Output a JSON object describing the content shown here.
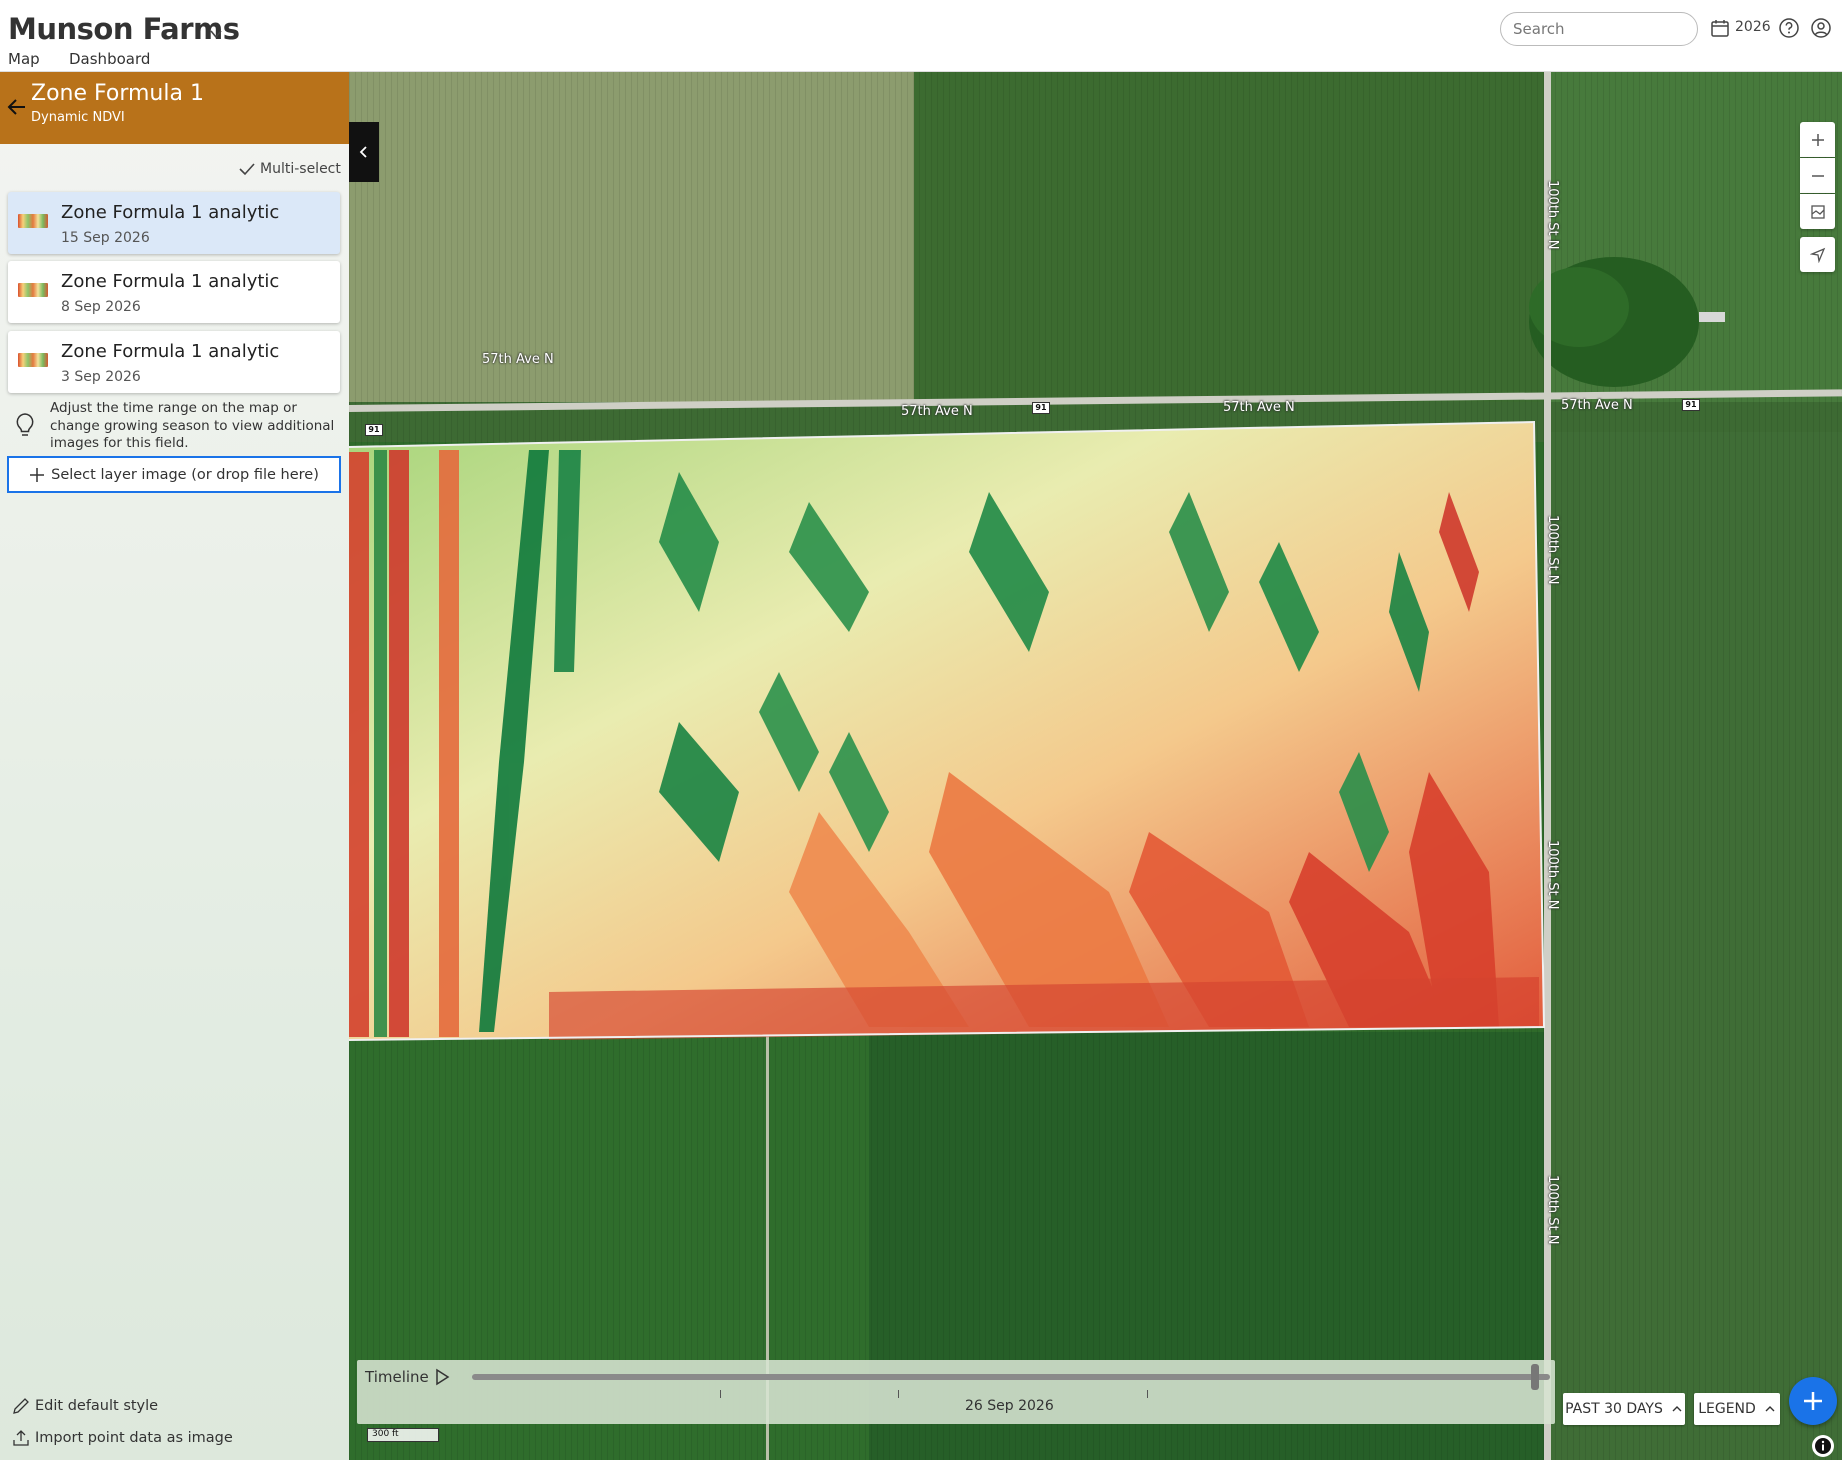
{
  "header": {
    "brand": "Munson Farms",
    "tabs": [
      {
        "label": "Map",
        "active": true
      },
      {
        "label": "Dashboard",
        "active": false
      }
    ],
    "search_placeholder": "Search",
    "year": "2026"
  },
  "sidebar": {
    "title": "Zone Formula 1",
    "subtitle": "Dynamic NDVI",
    "header_color": "#b8721a",
    "multiselect_label": "Multi-select",
    "items": [
      {
        "title": "Zone Formula 1 analytic",
        "date": "15 Sep 2026",
        "selected": true
      },
      {
        "title": "Zone Formula 1 analytic",
        "date": "8 Sep 2026",
        "selected": false
      },
      {
        "title": "Zone Formula 1 analytic",
        "date": "3 Sep 2026",
        "selected": false
      }
    ],
    "tip": "Adjust the time range on the map or change growing season to view additional images for this field.",
    "select_layer_label": "Select layer image (or drop file here)",
    "edit_style_label": "Edit default style",
    "import_label": "Import point data as image"
  },
  "map": {
    "road_labels": {
      "ave_1": "57th Ave N",
      "ave_2": "57th Ave N",
      "ave_3": "57th Ave N",
      "ave_4": "57th Ave N",
      "st_1": "100th St N",
      "st_2": "100th St N",
      "st_3": "100th St N",
      "st_4": "100th St N"
    },
    "route_shield": "91",
    "scale_label": "300 ft"
  },
  "timeline": {
    "label": "Timeline",
    "date": "26 Sep 2026",
    "position": 0.99
  },
  "controls": {
    "past_label": "PAST 30 DAYS",
    "legend_label": "LEGEND"
  },
  "colors": {
    "accent": "#1a73e8",
    "ndvi_low": "#c8312a",
    "ndvi_mid": "#f5e6a0",
    "ndvi_high": "#0c7a3e"
  },
  "icons": {
    "brand_chevron": "chevron-down-icon",
    "calendar": "calendar-icon",
    "help": "help-icon",
    "account": "account-icon",
    "back": "back-arrow-icon",
    "check": "check-icon",
    "tip": "lightbulb-icon",
    "add": "plus-icon",
    "edit": "pencil-icon",
    "import": "upload-icon",
    "collapse": "chevron-left-icon",
    "zoom_in": "plus-icon",
    "zoom_out": "minus-icon",
    "layers": "map-layers-icon",
    "locate": "locate-arrow-icon",
    "play": "play-icon",
    "fab": "plus-icon",
    "info": "info-icon"
  }
}
